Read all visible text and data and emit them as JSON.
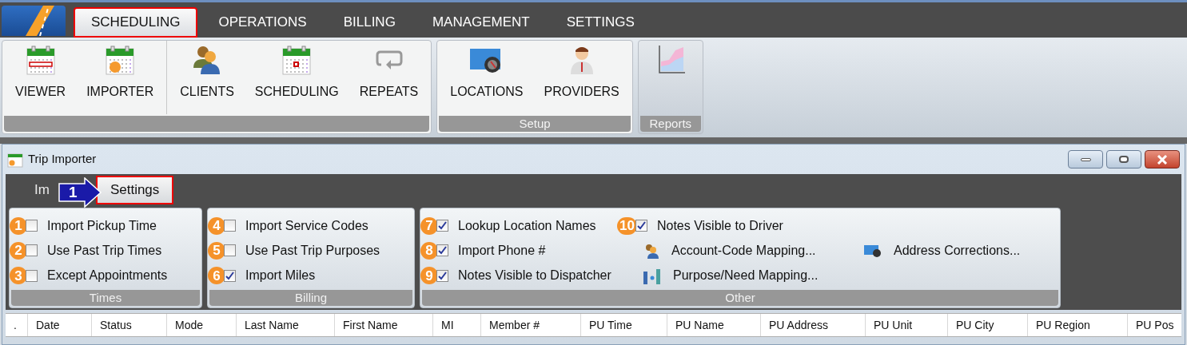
{
  "nav_tabs": [
    {
      "label": "SCHEDULING",
      "selected": true
    },
    {
      "label": "OPERATIONS",
      "selected": false
    },
    {
      "label": "BILLING",
      "selected": false
    },
    {
      "label": "MANAGEMENT",
      "selected": false
    },
    {
      "label": "SETTINGS",
      "selected": false
    }
  ],
  "ribbon_groups": [
    {
      "sections": [
        [
          {
            "label": "VIEWER",
            "kind": "viewer"
          },
          {
            "label": "IMPORTER",
            "kind": "importer"
          }
        ],
        [
          {
            "label": "CLIENTS",
            "kind": "clients"
          },
          {
            "label": "SCHEDULING",
            "kind": "schedule"
          },
          {
            "label": "REPEATS",
            "kind": "repeat"
          }
        ]
      ]
    },
    {
      "title": "Setup",
      "sections": [
        [
          {
            "label": "LOCATIONS",
            "kind": "map"
          },
          {
            "label": "PROVIDERS",
            "kind": "doctor"
          }
        ]
      ]
    },
    {
      "title": "Reports",
      "sections": [
        [
          {
            "kind": "chart"
          }
        ]
      ]
    }
  ],
  "window": {
    "title": "Trip Importer",
    "tabs": [
      {
        "label": "Im",
        "selected": false
      },
      {
        "label": "Settings",
        "selected": true
      }
    ],
    "callout": "1",
    "groups": [
      {
        "title": "Times",
        "items": [
          {
            "kind": "checkbox",
            "badge": "1",
            "label": "Import Pickup Time",
            "checked": false
          },
          {
            "kind": "checkbox",
            "badge": "2",
            "label": "Use Past Trip Times",
            "checked": false
          },
          {
            "kind": "checkbox",
            "badge": "3",
            "label": "Except Appointments",
            "checked": false
          }
        ]
      },
      {
        "title": "Billing",
        "items": [
          {
            "kind": "checkbox",
            "badge": "4",
            "label": "Import Service Codes",
            "checked": false
          },
          {
            "kind": "checkbox",
            "badge": "5",
            "label": "Use Past Trip Purposes",
            "checked": false
          },
          {
            "kind": "checkbox",
            "badge": "6",
            "label": "Import Miles",
            "checked": true
          }
        ]
      },
      {
        "title": "Other",
        "items": [
          {
            "kind": "checkbox",
            "badge": "7",
            "label": "Lookup Location Names",
            "checked": true
          },
          {
            "kind": "checkbox",
            "badge": "10",
            "label": "Notes Visible to Driver",
            "checked": true
          },
          {
            "kind": "blank"
          },
          {
            "kind": "checkbox",
            "badge": "8",
            "label": "Import Phone #",
            "checked": true
          },
          {
            "kind": "link",
            "label": "Account-Code Mapping..."
          },
          {
            "kind": "link",
            "label": "Address Corrections..."
          },
          {
            "kind": "checkbox",
            "badge": "9",
            "label": "Notes Visible to Dispatcher",
            "checked": true
          },
          {
            "kind": "link",
            "label": "Purpose/Need Mapping..."
          }
        ]
      }
    ]
  },
  "table": {
    "columns": [
      ".",
      "Date",
      "Status",
      "Mode",
      "Last Name",
      "First Name",
      "MI",
      "Member #",
      "PU Time",
      "PU Name",
      "PU Address",
      "PU Unit",
      "PU City",
      "PU Region",
      "PU Pos"
    ]
  }
}
